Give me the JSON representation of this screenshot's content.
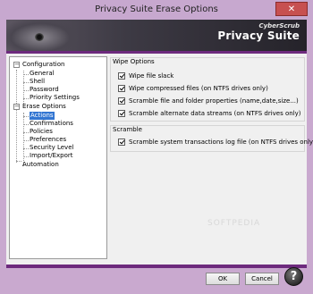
{
  "window": {
    "title": "Privacy Suite Erase Options",
    "close_glyph": "✕"
  },
  "banner": {
    "brand_line1": "CyberScrub",
    "brand_line2": "Privacy Suite"
  },
  "tree": {
    "configuration": "Configuration",
    "general": "General",
    "shell": "Shell",
    "password": "Password",
    "priority_settings": "Priority Settings",
    "erase_options": "Erase Options",
    "actions": "Actions",
    "confirmations": "Confirmations",
    "policies": "Policies",
    "preferences": "Preferences",
    "security_level": "Security Level",
    "import_export": "Import/Export",
    "automation": "Automation",
    "expanded_glyph": "−"
  },
  "wipe_options": {
    "title": "Wipe Options",
    "items": [
      {
        "label": "Wipe file slack",
        "checked": true
      },
      {
        "label": "Wipe compressed files (on NTFS drives only)",
        "checked": true
      },
      {
        "label": "Scramble file and folder properties (name,date,size...)",
        "checked": true
      },
      {
        "label": "Scramble alternate data streams (on NTFS drives only)",
        "checked": true
      }
    ]
  },
  "scramble": {
    "title": "Scramble",
    "items": [
      {
        "label": "Scramble system transactions log file (on NTFS drives only)",
        "checked": true
      }
    ]
  },
  "watermark": "SOFTPEDIA",
  "buttons": {
    "ok": "OK",
    "cancel": "Cancel",
    "help": "?"
  }
}
